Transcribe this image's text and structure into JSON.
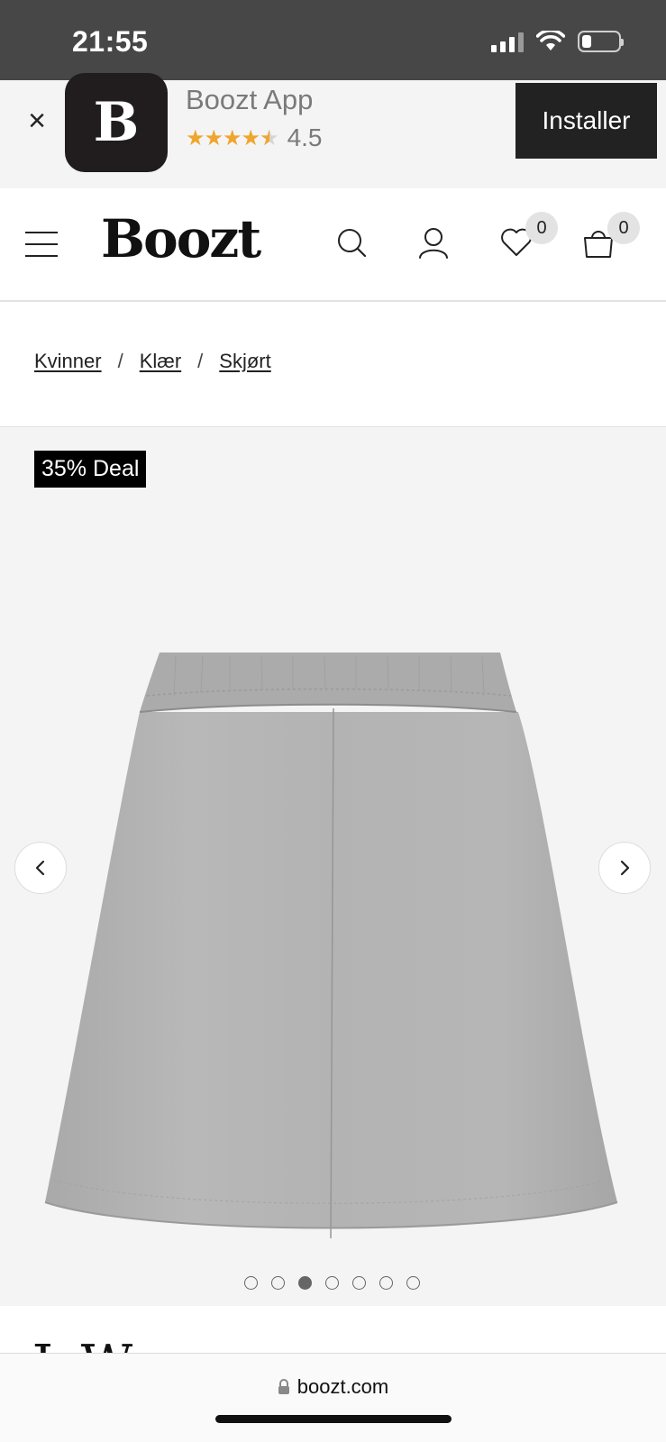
{
  "status_bar": {
    "time": "21:55",
    "battery_level": 0.25
  },
  "app_banner": {
    "close_icon": "close-icon",
    "app_icon_letter": "B",
    "app_name": "Boozt App",
    "stars": 4.5,
    "rating": "4.5",
    "install_label": "Installer"
  },
  "header": {
    "logo": "Boozt",
    "wishlist_count": "0",
    "cart_count": "0",
    "icons": [
      "menu-icon",
      "search-icon",
      "user-icon",
      "heart-icon",
      "bag-icon"
    ]
  },
  "breadcrumb": {
    "items": [
      "Kvinner",
      "Klær",
      "Skjørt"
    ],
    "separator": "/"
  },
  "product": {
    "deal_badge": "35% Deal",
    "image_alt": "grey skirt",
    "gallery_count": 7,
    "gallery_active_index": 2,
    "partial_title": "J. W"
  },
  "browser": {
    "url": "boozt.com"
  }
}
